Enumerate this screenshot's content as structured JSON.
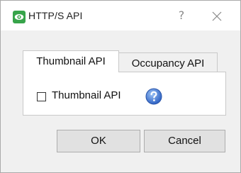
{
  "window": {
    "title": "HTTP/S API",
    "help_label": "?"
  },
  "tabs": [
    {
      "label": "Thumbnail API",
      "active": true
    },
    {
      "label": "Occupancy API",
      "active": false
    }
  ],
  "panel": {
    "checkbox_label": "Thumbnail API",
    "checkbox_checked": false
  },
  "buttons": {
    "ok_label": "OK",
    "cancel_label": "Cancel"
  },
  "colors": {
    "app_icon": "#37a44a",
    "info_icon": "#3d76d6"
  },
  "icons": [
    "eye-icon",
    "close-icon",
    "info-question-icon"
  ]
}
